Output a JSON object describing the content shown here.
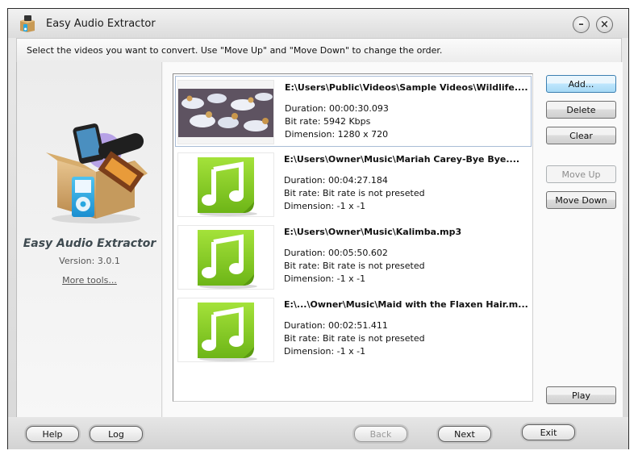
{
  "window": {
    "title": "Easy Audio Extractor",
    "minimize_icon": "minimize-icon",
    "close_icon": "close-icon"
  },
  "instruction": "Select the videos you want to convert. Use \"Move Up\" and \"Move Down\" to change the order.",
  "sidebar": {
    "logo_icon": "software-box-icon",
    "brand": "Easy Audio Extractor",
    "version": "Version: 3.0.1",
    "more_tools": "More tools..."
  },
  "files": [
    {
      "type": "video",
      "thumbnail": "video-thumbnail-birds",
      "name": "E:\\Users\\Public\\Videos\\Sample Videos\\Wildlife....",
      "duration": "Duration: 00:00:30.093",
      "bitrate": "Bit rate: 5942 Kbps",
      "dimension": "Dimension: 1280 x 720",
      "selected": true
    },
    {
      "type": "audio",
      "thumbnail": "music-note-icon",
      "name": "E:\\Users\\Owner\\Music\\Mariah Carey-Bye Bye....",
      "duration": "Duration: 00:04:27.184",
      "bitrate": "Bit rate: Bit rate is not preseted",
      "dimension": "Dimension: -1 x -1",
      "selected": false
    },
    {
      "type": "audio",
      "thumbnail": "music-note-icon",
      "name": "E:\\Users\\Owner\\Music\\Kalimba.mp3",
      "duration": "Duration: 00:05:50.602",
      "bitrate": "Bit rate: Bit rate is not preseted",
      "dimension": "Dimension: -1 x -1",
      "selected": false
    },
    {
      "type": "audio",
      "thumbnail": "music-note-icon",
      "name": "E:\\...\\Owner\\Music\\Maid with the Flaxen Hair.m...",
      "duration": "Duration: 00:02:51.411",
      "bitrate": "Bit rate: Bit rate is not preseted",
      "dimension": "Dimension: -1 x -1",
      "selected": false
    }
  ],
  "actions": {
    "add": "Add...",
    "delete": "Delete",
    "clear": "Clear",
    "move_up": "Move Up",
    "move_down": "Move Down",
    "play": "Play"
  },
  "footer": {
    "help": "Help",
    "log": "Log",
    "back": "Back",
    "next": "Next",
    "exit": "Exit"
  },
  "colors": {
    "selection_border": "#a9bcd6",
    "primary_button": "#bee6fd",
    "music_icon_green": "#7cc51c"
  }
}
